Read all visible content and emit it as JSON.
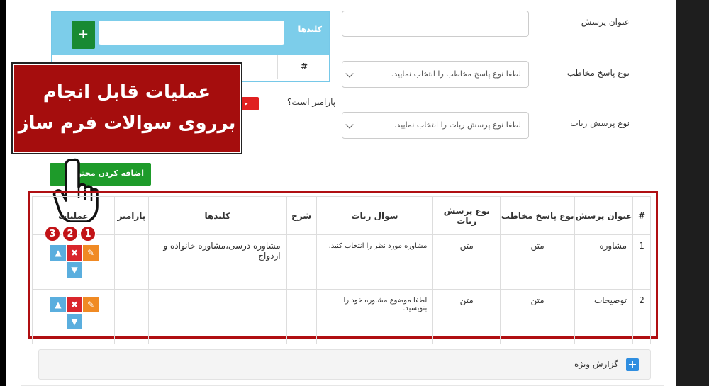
{
  "form": {
    "question_title_label": "عنوان پرسش",
    "answer_type_label": "نوع پاسخ مخاطب",
    "answer_type_placeholder": "لطفا نوع پاسخ مخاطب را انتخاب نمایید.",
    "bot_question_type_label": "نوع پرسش ربات",
    "bot_question_type_placeholder": "لطفا نوع پرسش ربات را انتخاب نمایید.",
    "is_parameter_label": "پارامتر است؟",
    "add_content_button": "اضافه کردن محتوا"
  },
  "keywords": {
    "title": "کلیدها",
    "add_icon": "+",
    "table_hash": "#"
  },
  "callout": {
    "line1": "عملیات قابل انجام",
    "line2": "برروی سوالات فرم ساز"
  },
  "table": {
    "headers": [
      "#",
      "عنوان پرسش",
      "نوع پاسخ مخاطب",
      "نوع پرسش ربات",
      "سوال ربات",
      "شرح",
      "کلیدها",
      "پارامتر",
      "عملیات"
    ],
    "rows": [
      {
        "num": "1",
        "title": "مشاوره",
        "answer_type": "متن",
        "bot_type": "متن",
        "bot_question": "مشاوره مورد نظر را انتخاب کنید.",
        "desc": "",
        "keys": "مشاوره درسی،مشاوره خانواده و ازدواج",
        "param": ""
      },
      {
        "num": "2",
        "title": "توضیحات",
        "answer_type": "متن",
        "bot_type": "متن",
        "bot_question": "لطفا موضوع مشاوره خود را بنویسید.",
        "desc": "",
        "keys": "",
        "param": ""
      }
    ],
    "badges": [
      "1",
      "2",
      "3"
    ]
  },
  "report": {
    "label": "گزارش ویژه",
    "icon": "+"
  },
  "colors": {
    "callout_bg": "#a50d0d",
    "frame": "#b00f12",
    "edit": "#f08a24",
    "delete": "#d9262c",
    "move": "#5aaede",
    "keywords_header": "#7ccdea",
    "add_button": "#1e9b2a"
  }
}
